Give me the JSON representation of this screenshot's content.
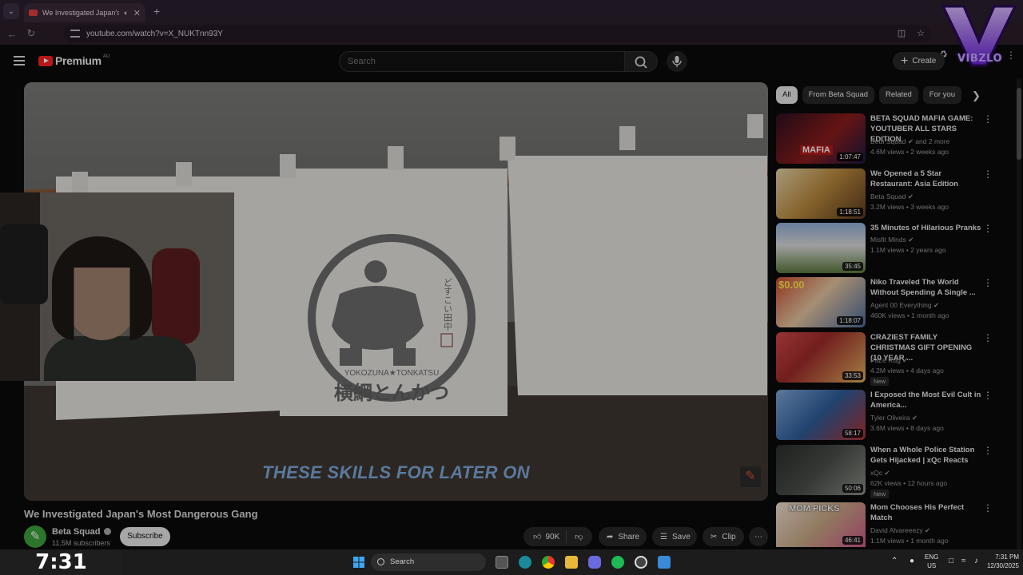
{
  "browser": {
    "tab_title": "We Investigated Japan's Mo",
    "url": "youtube.com/watch?v=X_NUKTnn93Y"
  },
  "youtube": {
    "logo_text": "Premium",
    "country": "AU",
    "search_placeholder": "Search",
    "create_label": "Create"
  },
  "watermark": {
    "text": "VIBZLO"
  },
  "player": {
    "caption": "THESE SKILLS FOR LATER ON",
    "emblem_text": "YOKOZUNA★TONKATSU",
    "emblem_kanji": "横綱とんかつ",
    "emblem_vertical": "どすこい田中"
  },
  "video": {
    "title": "We Investigated Japan's Most Dangerous Gang",
    "channel": "Beta Squad",
    "subscribers": "11.5M subscribers",
    "subscribe_label": "Subscribe",
    "likes": "90K",
    "share_label": "Share",
    "save_label": "Save",
    "clip_label": "Clip"
  },
  "chips": [
    "All",
    "From Beta Squad",
    "Related",
    "For you"
  ],
  "recommendations": [
    {
      "title": "BETA SQUAD MAFIA GAME: YOUTUBER ALL STARS EDITION",
      "channel": "Beta Squad",
      "channel_extra": "and 2 more",
      "meta": "4.6M views • 2 weeks ago",
      "duration": "1:07:47",
      "new": "",
      "thumb_color": "#8c1c1c"
    },
    {
      "title": "We Opened a 5 Star Restaurant: Asia Edition",
      "channel": "Beta Squad",
      "channel_extra": "",
      "meta": "3.2M views • 3 weeks ago",
      "duration": "1:18:51",
      "new": "",
      "thumb_color": "#b8863a"
    },
    {
      "title": "35 Minutes of Hilarious Pranks",
      "channel": "Misfit Minds",
      "channel_extra": "",
      "meta": "1.1M views • 2 years ago",
      "duration": "35:45",
      "new": "",
      "thumb_color": "#5b7a3c"
    },
    {
      "title": "Niko Traveled The World Without Spending A Single ...",
      "channel": "Agent 00 Everything",
      "channel_extra": "",
      "meta": "460K views • 1 month ago",
      "duration": "1:18:07",
      "new": "",
      "thumb_color": "#c94a2e"
    },
    {
      "title": "CRAZIEST FAMILY CHRISTMAS GIFT OPENING (10 YEAR ...",
      "channel": "FaZe Rug",
      "channel_extra": "",
      "meta": "4.2M views • 4 days ago",
      "duration": "33:53",
      "new": "New",
      "thumb_color": "#9e2a2a"
    },
    {
      "title": "I Exposed the Most Evil Cult in America...",
      "channel": "Tyler Oliveira",
      "channel_extra": "",
      "meta": "3.6M views • 8 days ago",
      "duration": "58:17",
      "new": "",
      "thumb_color": "#2d5d9a"
    },
    {
      "title": "When a Whole Police Station Gets Hijacked | xQc Reacts",
      "channel": "xQc",
      "channel_extra": "",
      "meta": "62K views • 12 hours ago",
      "duration": "50:06",
      "new": "New",
      "thumb_color": "#4a4f4a"
    },
    {
      "title": "Mom Chooses His Perfect Match",
      "channel": "David Alvareeezy",
      "channel_extra": "",
      "meta": "1.1M views • 1 month ago",
      "duration": "46:41",
      "new": "",
      "thumb_color": "#c9a886"
    }
  ],
  "thumb_labels": {
    "mafia": "MAFIA",
    "zero": "$0.00",
    "mom": "MOM PICKS"
  },
  "stream_timer": "7:31",
  "taskbar": {
    "search_label": "Search",
    "lang": "ENG",
    "region": "US",
    "time": "7:31 PM",
    "date": "12/30/2025"
  }
}
